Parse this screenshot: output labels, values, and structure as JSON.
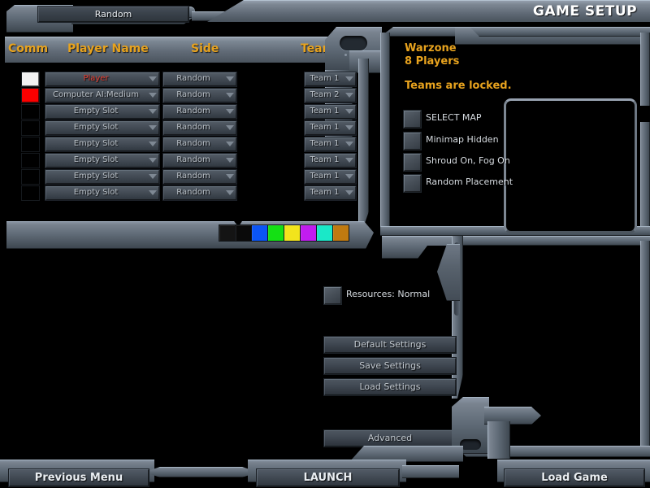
{
  "window": {
    "title": "GAME SETUP"
  },
  "columns": {
    "comm": "Comm",
    "player_name": "Player Name",
    "side": "Side",
    "teams": "Teams"
  },
  "players": [
    {
      "color": "#f2f2f2",
      "name": "Player",
      "is_you": true,
      "side": "Random",
      "team": "Team 1"
    },
    {
      "color": "#fb0000",
      "name": "Computer AI:Medium",
      "is_you": false,
      "side": "Random",
      "team": "Team 2"
    },
    {
      "color": "#000000",
      "name": "Empty Slot",
      "is_you": false,
      "side": "Random",
      "team": "Team 1"
    },
    {
      "color": "#000000",
      "name": "Empty Slot",
      "is_you": false,
      "side": "Random",
      "team": "Team 1"
    },
    {
      "color": "#000000",
      "name": "Empty Slot",
      "is_you": false,
      "side": "Random",
      "team": "Team 1"
    },
    {
      "color": "#000000",
      "name": "Empty Slot",
      "is_you": false,
      "side": "Random",
      "team": "Team 1"
    },
    {
      "color": "#000000",
      "name": "Empty Slot",
      "is_you": false,
      "side": "Random",
      "team": "Team 1"
    },
    {
      "color": "#000000",
      "name": "Empty Slot",
      "is_you": false,
      "side": "Random",
      "team": "Team 1"
    }
  ],
  "toolbar": {
    "random_label": "Random",
    "palette": [
      "#141414",
      "#0a0a0a",
      "#0b55f5",
      "#14e014",
      "#f2e41c",
      "#c21cf0",
      "#1ae8c8",
      "#c07a10"
    ]
  },
  "map_panel": {
    "map_name": "Warzone",
    "player_count": "8 Players",
    "team_status": "Teams are locked.",
    "options": [
      {
        "label": "SELECT MAP",
        "checked": false
      },
      {
        "label": "Minimap Hidden",
        "checked": false
      },
      {
        "label": "Shroud On, Fog On",
        "checked": false
      },
      {
        "label": "Random Placement",
        "checked": false
      }
    ]
  },
  "settings": {
    "resources_label": "Resources: Normal",
    "buttons": [
      "Default Settings",
      "Save Settings",
      "Load Settings"
    ],
    "advanced_label": "Advanced"
  },
  "bottom_bar": {
    "previous_menu": "Previous Menu",
    "launch": "LAUNCH",
    "load_game": "Load Game"
  },
  "colors": {
    "accent": "#e8a31e",
    "you_name": "#e23b2e",
    "metal_light": "#8e99a8",
    "metal_dark": "#3c454e"
  }
}
